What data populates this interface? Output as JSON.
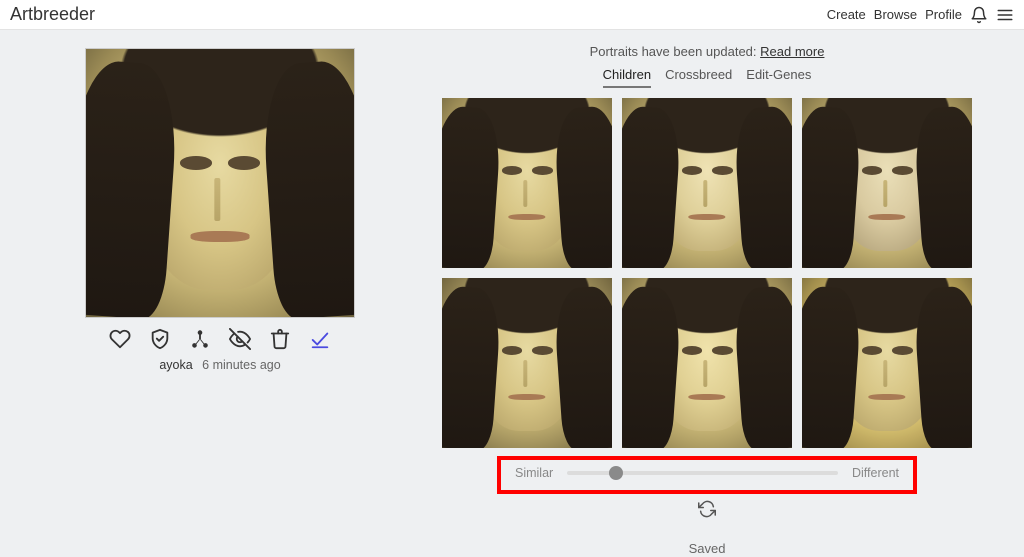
{
  "header": {
    "brand": "Artbreeder",
    "nav": {
      "create": "Create",
      "browse": "Browse",
      "profile": "Profile"
    }
  },
  "banner": {
    "text": "Portraits have been updated: ",
    "link": "Read more"
  },
  "tabs": {
    "children": "Children",
    "crossbreed": "Crossbreed",
    "edit_genes": "Edit-Genes",
    "active": "children"
  },
  "meta": {
    "author": "ayoka",
    "age": "6 minutes ago"
  },
  "slider": {
    "left": "Similar",
    "right": "Different"
  },
  "saved_label": "Saved"
}
